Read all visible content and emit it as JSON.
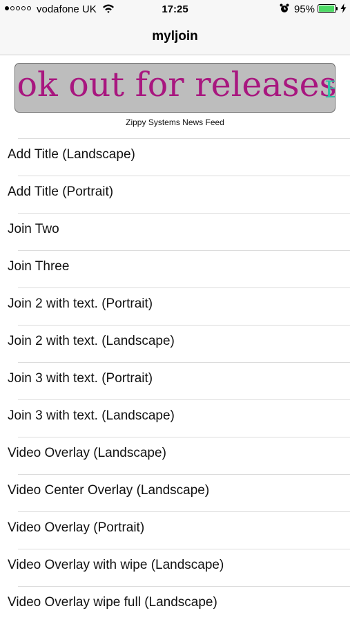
{
  "status_bar": {
    "signal_bars_filled": 1,
    "signal_bars_total": 5,
    "carrier": "vodafone UK",
    "time": "17:25",
    "battery_percent": "95%",
    "battery_level": 0.95,
    "battery_color": "#4cd964"
  },
  "nav": {
    "title": "myljoin"
  },
  "banner": {
    "text": "ook out for releases",
    "next_text": "E",
    "caption": "Zippy Systems News Feed",
    "text_color": "#a8177f",
    "background": "#bdbdbd"
  },
  "menu": {
    "items": [
      {
        "label": "Add Title (Landscape)"
      },
      {
        "label": "Add Title (Portrait)"
      },
      {
        "label": "Join Two"
      },
      {
        "label": "Join Three"
      },
      {
        "label": "Join 2 with text. (Portrait)"
      },
      {
        "label": "Join 2 with text. (Landscape)"
      },
      {
        "label": "Join 3 with text. (Portrait)"
      },
      {
        "label": "Join 3 with text. (Landscape)"
      },
      {
        "label": "Video Overlay (Landscape)"
      },
      {
        "label": "Video Center Overlay (Landscape)"
      },
      {
        "label": "Video Overlay (Portrait)"
      },
      {
        "label": "Video Overlay with wipe (Landscape)"
      },
      {
        "label": "Video Overlay wipe full (Landscape)"
      }
    ]
  }
}
